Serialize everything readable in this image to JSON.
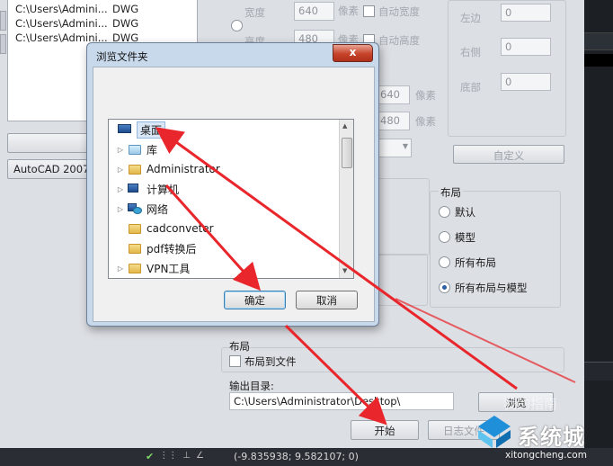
{
  "files": [
    {
      "path": "C:\\Users\\Admini...",
      "type": "DWG"
    },
    {
      "path": "C:\\Users\\Admini...",
      "type": "DWG"
    },
    {
      "path": "C:\\Users\\Admini...",
      "type": "DWG"
    }
  ],
  "left_panel": {
    "version_select": "AutoCAD 2007 D"
  },
  "size_section": {
    "width_label": "宽度",
    "width_value": "640",
    "height_label": "高度",
    "height_value": "480",
    "unit_label": "像素",
    "auto_width_label": "自动宽度",
    "auto_height_label": "自动高度",
    "value2_w": "640",
    "value2_h": "480",
    "unit2": "像素",
    "unit3": "像素"
  },
  "margin_section": {
    "left_label": "左边",
    "left_value": "0",
    "right_label": "右侧",
    "right_value": "0",
    "bottom_label": "底部",
    "bottom_value": "0",
    "custom_button": "自定义"
  },
  "layout_section": {
    "title": "布局",
    "options": [
      {
        "label": "默认",
        "selected": false
      },
      {
        "label": "模型",
        "selected": false
      },
      {
        "label": "所有布局",
        "selected": false
      },
      {
        "label": "所有布局与模型",
        "selected": true
      }
    ]
  },
  "layout2": {
    "title": "布局",
    "to_file_label": "布局到文件"
  },
  "output": {
    "label": "输出目录:",
    "path": "C:\\Users\\Administrator\\Desktop\\",
    "browse_button": "浏览",
    "start_button": "开始",
    "log_button": "日志文件"
  },
  "dialog": {
    "title": "浏览文件夹",
    "close": "x",
    "tree": [
      {
        "label": "桌面",
        "icon": "desktop-icon",
        "selected": true,
        "expander": ""
      },
      {
        "label": "库",
        "icon": "library-icon",
        "selected": false,
        "expander": "▷"
      },
      {
        "label": "Administrator",
        "icon": "user-folder-icon",
        "selected": false,
        "expander": "▷"
      },
      {
        "label": "计算机",
        "icon": "computer-icon",
        "selected": false,
        "expander": "▷"
      },
      {
        "label": "网络",
        "icon": "network-icon",
        "selected": false,
        "expander": "▷"
      },
      {
        "label": "cadconveter",
        "icon": "folder-icon",
        "selected": false,
        "expander": ""
      },
      {
        "label": "pdf转换后",
        "icon": "folder-icon",
        "selected": false,
        "expander": ""
      },
      {
        "label": "VPN工具",
        "icon": "folder-icon",
        "selected": false,
        "expander": "▷"
      }
    ],
    "ok_button": "确定",
    "cancel_button": "取消"
  },
  "statusbar": {
    "coords": "(-9.835938; 9.582107; 0)"
  },
  "watermark": {
    "brand": "系统城",
    "url": "xitongcheng.com",
    "tag": "我的指南"
  },
  "colors": {
    "accent_red": "#e8262b",
    "selection_blue": "#d8e6f5"
  }
}
